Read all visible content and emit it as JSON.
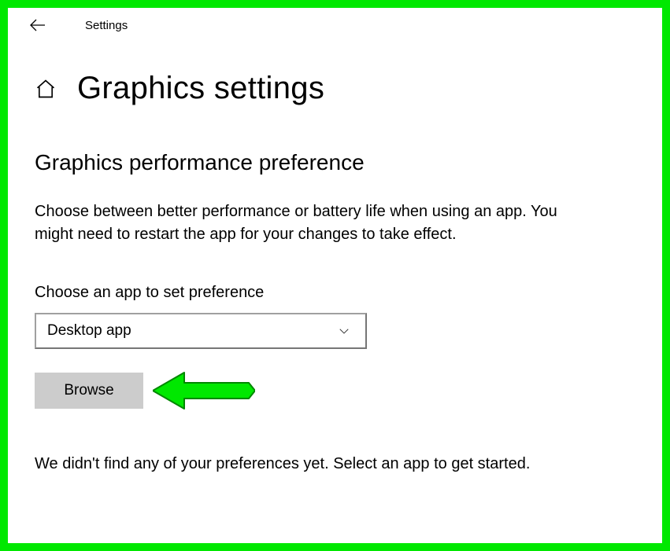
{
  "header": {
    "title": "Settings"
  },
  "page": {
    "title": "Graphics settings"
  },
  "section": {
    "heading": "Graphics performance preference",
    "description": "Choose between better performance or battery life when using an app. You might need to restart the app for your changes to take effect.",
    "field_label": "Choose an app to set preference",
    "dropdown_value": "Desktop app",
    "browse_label": "Browse",
    "footer_text": "We didn't find any of your preferences yet. Select an app to get started."
  },
  "annotation": {
    "arrow_color": "#00c800"
  }
}
